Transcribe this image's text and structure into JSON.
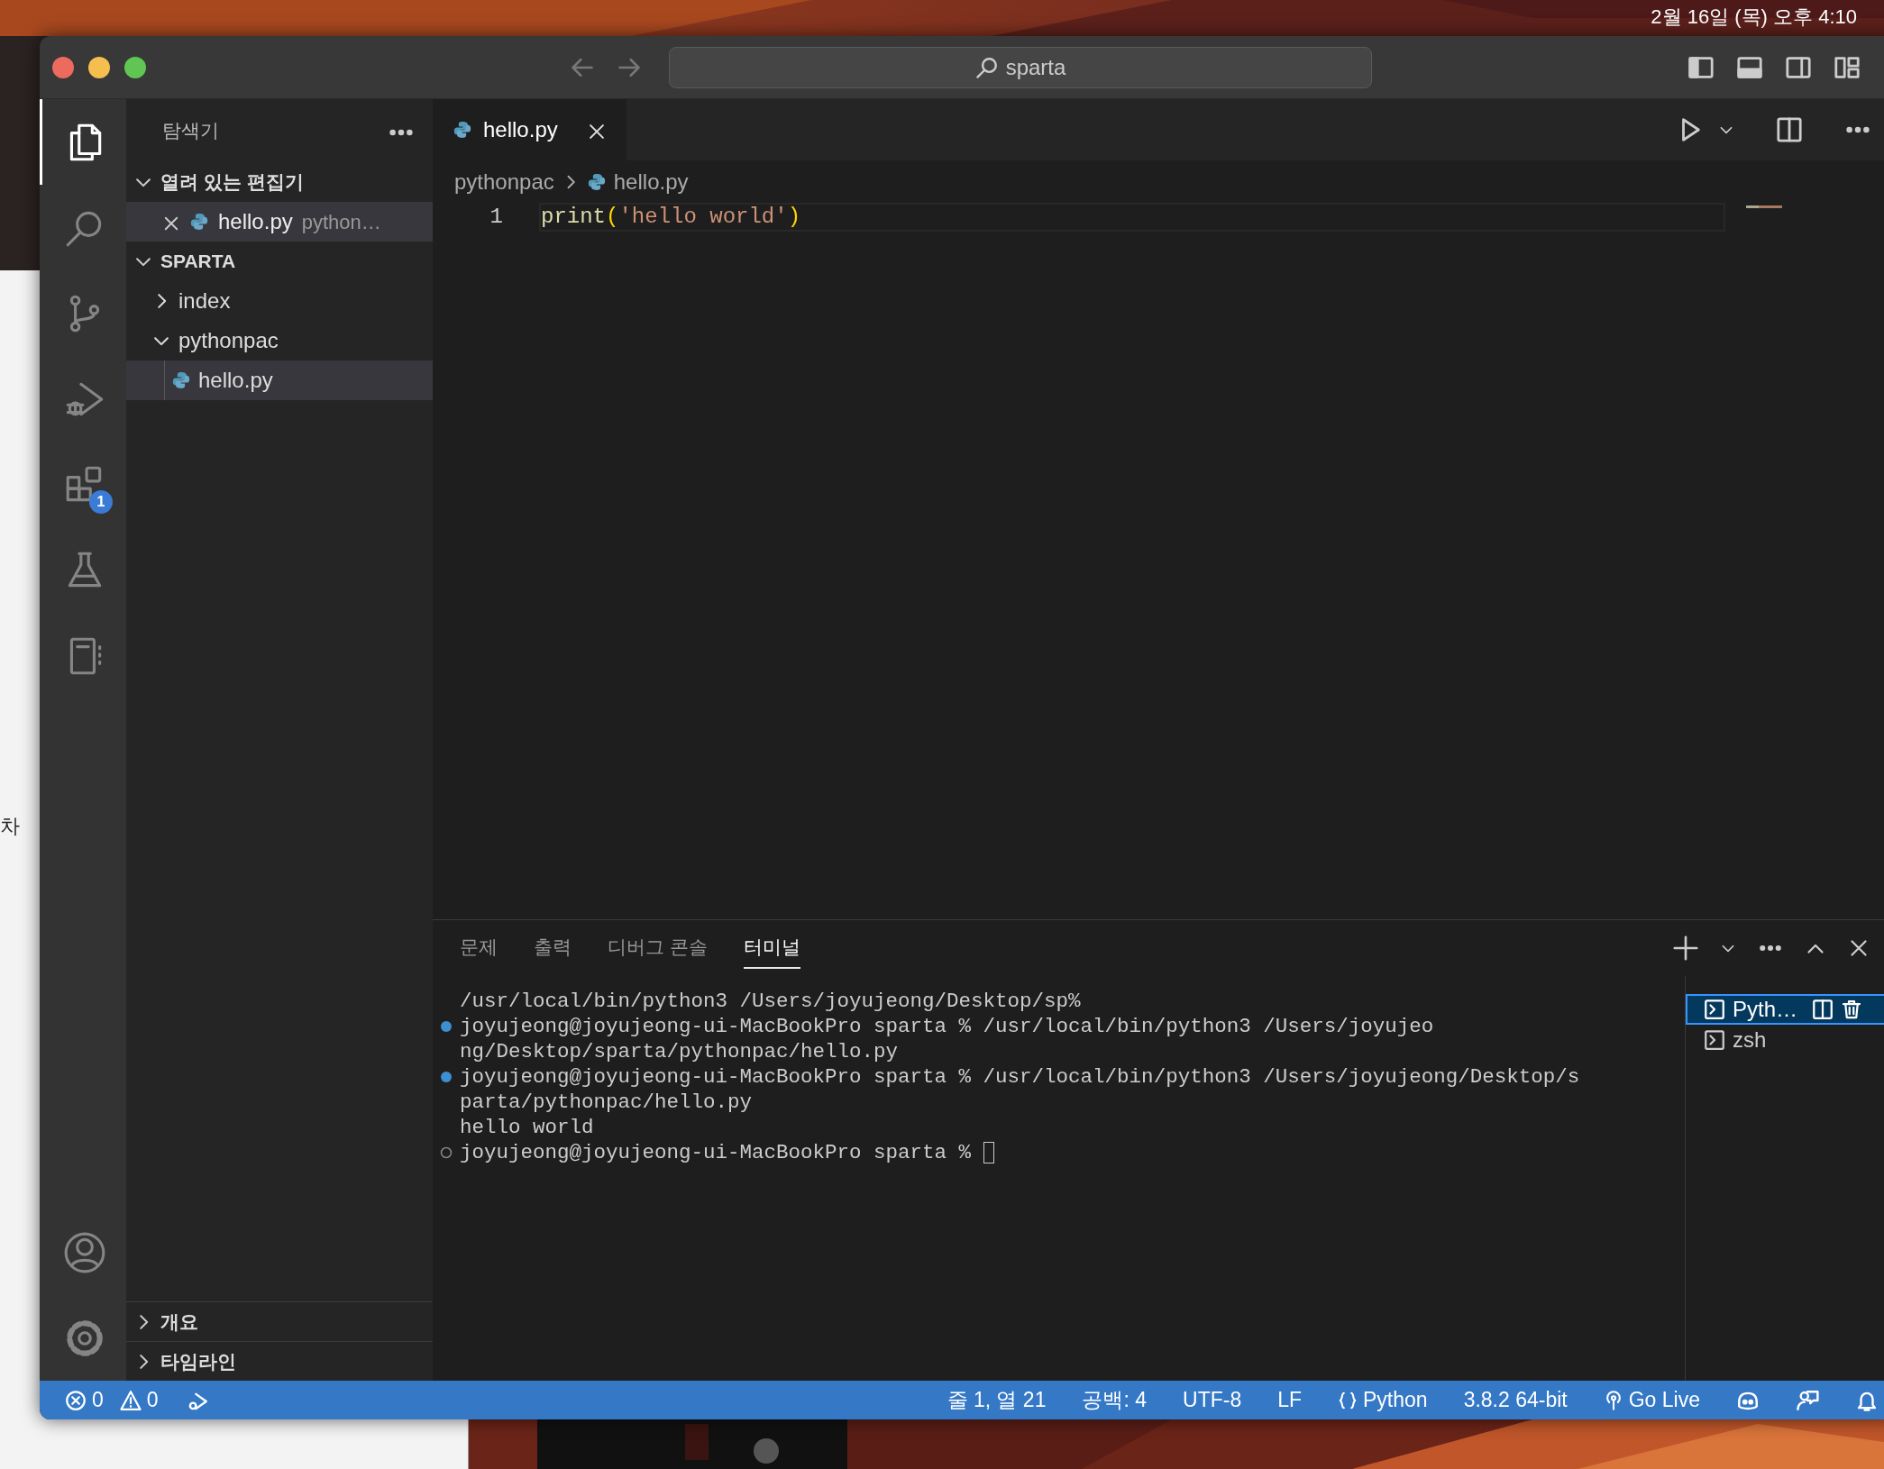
{
  "menubar": {
    "clock": "2월 16일 (목) 오후 4:10"
  },
  "background_window": {
    "text": "차"
  },
  "titlebar": {
    "search": "sparta"
  },
  "activity_bar": {
    "items": [
      {
        "selected": true
      },
      {
        "selected": false
      },
      {
        "selected": false
      },
      {
        "selected": false
      },
      {
        "selected": false,
        "badge": "1"
      },
      {
        "selected": false
      },
      {
        "selected": false
      }
    ]
  },
  "sidebar": {
    "title": "탐색기",
    "open_editors": {
      "title": "열려 있는 편집기",
      "expanded": true,
      "items": [
        {
          "name": "hello.py",
          "description": "python…",
          "selected": true
        }
      ]
    },
    "explorer": {
      "title": "SPARTA",
      "expanded": true,
      "tree": [
        {
          "kind": "folder",
          "name": "index",
          "expanded": false
        },
        {
          "kind": "folder",
          "name": "pythonpac",
          "expanded": true,
          "children": [
            {
              "kind": "file",
              "name": "hello.py",
              "selected": true
            }
          ]
        }
      ]
    },
    "bottom_sections": [
      {
        "title": "개요",
        "expanded": false
      },
      {
        "title": "타임라인",
        "expanded": false
      }
    ]
  },
  "editor": {
    "tabs": [
      {
        "label": "hello.py",
        "selected": true
      }
    ],
    "breadcrumbs": [
      "pythonpac",
      "hello.py"
    ],
    "lines": [
      {
        "number": "1",
        "tokens": [
          {
            "kind": "function",
            "text": "print"
          },
          {
            "kind": "bracket",
            "text": "("
          },
          {
            "kind": "string",
            "text": "'hello world'"
          },
          {
            "kind": "bracket",
            "text": ")"
          }
        ]
      }
    ]
  },
  "panel": {
    "tabs": [
      {
        "label": "문제",
        "selected": false
      },
      {
        "label": "출력",
        "selected": false
      },
      {
        "label": "디버그 콘솔",
        "selected": false
      },
      {
        "label": "터미널",
        "selected": true
      }
    ],
    "terminal_lines": [
      {
        "kind": "plain",
        "text": "/usr/local/bin/python3 /Users/joyujeong/Desktop/sp%"
      },
      {
        "kind": "success",
        "text": "joyujeong@joyujeong-ui-MacBookPro sparta % /usr/local/bin/python3 /Users/joyujeo"
      },
      {
        "kind": "plain",
        "text": "ng/Desktop/sparta/pythonpac/hello.py"
      },
      {
        "kind": "success",
        "text": "joyujeong@joyujeong-ui-MacBookPro sparta % /usr/local/bin/python3 /Users/joyujeong/Desktop/s"
      },
      {
        "kind": "plain",
        "text": "parta/pythonpac/hello.py"
      },
      {
        "kind": "plain",
        "text": "hello world"
      },
      {
        "kind": "pending",
        "text": "joyujeong@joyujeong-ui-MacBookPro sparta % ",
        "cursor": true
      }
    ],
    "terminals": [
      {
        "label": "Pyth…",
        "selected": true
      },
      {
        "label": "zsh",
        "selected": false
      }
    ]
  },
  "status_bar": {
    "errors": "0",
    "warnings": "0",
    "items": [
      {
        "kind": "text",
        "text": "줄 1, 열 21"
      },
      {
        "kind": "text",
        "text": "공백: 4"
      },
      {
        "kind": "text",
        "text": "UTF-8"
      },
      {
        "kind": "text",
        "text": "LF"
      },
      {
        "kind": "braces",
        "text": "Python"
      },
      {
        "kind": "text",
        "text": "3.8.2 64-bit"
      },
      {
        "kind": "broadcast",
        "text": "Go Live"
      },
      {
        "kind": "copilot"
      },
      {
        "kind": "feedback"
      },
      {
        "kind": "bell"
      }
    ]
  }
}
